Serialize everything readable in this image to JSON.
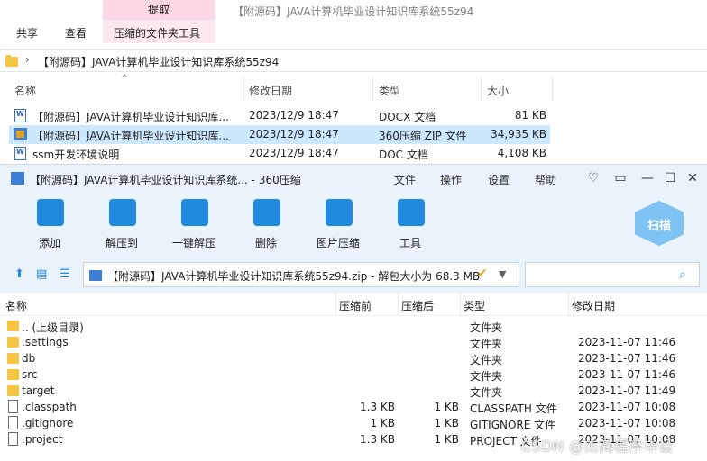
{
  "explorer": {
    "ribbon": {
      "context_tab": "提取",
      "tabs": [
        "共享",
        "查看",
        "压缩的文件夹工具"
      ],
      "window_title": "【附源码】JAVA计算机毕业设计知识库系统55z94"
    },
    "address": {
      "path": "【附源码】JAVA计算机毕业设计知识库系统55z94"
    },
    "columns": [
      "名称",
      "修改日期",
      "类型",
      "大小"
    ],
    "files": [
      {
        "name": "【附源码】JAVA计算机毕业设计知识库...",
        "date": "2023/12/9 18:47",
        "type": "DOCX 文档",
        "size": "81 KB",
        "icon": "word-doc-icon"
      },
      {
        "name": "【附源码】JAVA计算机毕业设计知识库...",
        "date": "2023/12/9 18:47",
        "type": "360压缩 ZIP 文件",
        "size": "34,935 KB",
        "icon": "zip-archive-icon"
      },
      {
        "name": "ssm开发环境说明",
        "date": "2023/12/9 18:47",
        "type": "DOC 文档",
        "size": "4,108 KB",
        "icon": "word-doc-icon"
      }
    ]
  },
  "zipwin": {
    "title": "【附源码】JAVA计算机毕业设计知识库系统... - 360压缩",
    "menu": [
      "文件",
      "操作",
      "设置",
      "帮助"
    ],
    "toolbar": [
      {
        "label": "添加",
        "icon": "add-icon"
      },
      {
        "label": "解压到",
        "icon": "extract-to-icon"
      },
      {
        "label": "一键解压",
        "icon": "one-click-extract-icon"
      },
      {
        "label": "删除",
        "icon": "delete-icon"
      },
      {
        "label": "图片压缩",
        "icon": "image-compress-icon"
      },
      {
        "label": "工具",
        "icon": "tools-icon"
      }
    ],
    "scan_label": "扫描",
    "path": "【附源码】JAVA计算机毕业设计知识库系统55z94.zip - 解包大小为 68.3 MB",
    "columns": [
      "名称",
      "压缩前",
      "压缩后",
      "类型",
      "修改日期"
    ],
    "rows": [
      {
        "name": ".. (上级目录)",
        "before": "",
        "after": "",
        "type": "文件夹",
        "date": "",
        "kind": "folder"
      },
      {
        "name": ".settings",
        "before": "",
        "after": "",
        "type": "文件夹",
        "date": "2023-11-07 11:46",
        "kind": "folder"
      },
      {
        "name": "db",
        "before": "",
        "after": "",
        "type": "文件夹",
        "date": "2023-11-07 11:46",
        "kind": "folder"
      },
      {
        "name": "src",
        "before": "",
        "after": "",
        "type": "文件夹",
        "date": "2023-11-07 11:46",
        "kind": "folder"
      },
      {
        "name": "target",
        "before": "",
        "after": "",
        "type": "文件夹",
        "date": "2023-11-07 11:49",
        "kind": "folder"
      },
      {
        "name": ".classpath",
        "before": "1.3 KB",
        "after": "1 KB",
        "type": "CLASSPATH 文件",
        "date": "2023-11-07 10:08",
        "kind": "file"
      },
      {
        "name": ".gitignore",
        "before": "1 KB",
        "after": "1 KB",
        "type": "GITIGNORE 文件",
        "date": "2023-11-07 10:08",
        "kind": "file"
      },
      {
        "name": ".project",
        "before": "1.3 KB",
        "after": "1 KB",
        "type": "PROJECT 文件",
        "date": "2023-11-07 10:08",
        "kind": "file"
      }
    ]
  },
  "watermark": "CSDN @杰简程序毕设",
  "colors": {
    "accent": "#1f8ae0",
    "ribbon_highlight": "#fbd6e5",
    "selection": "#cce8ff",
    "window_bg": "#eaf2fb"
  }
}
